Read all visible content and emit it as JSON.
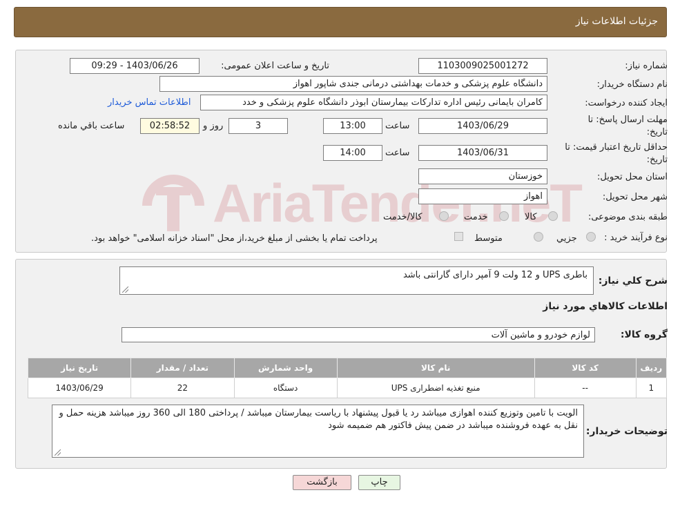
{
  "header": {
    "title": "جزئیات اطلاعات نیاز"
  },
  "labels": {
    "need_number": "شماره نیاز:",
    "announce_datetime": "تاریخ و ساعت اعلان عمومی:",
    "buyer_org": "نام دستگاه خریدار:",
    "requester": "ایجاد کننده درخواست:",
    "deadline_line1": "مهلت ارسال پاسخ: تا",
    "deadline_line2": "تاریخ:",
    "time_word": "ساعت",
    "day_word": "روز و",
    "remaining_suffix": "ساعت باقي مانده",
    "validity_line1": "حداقل تاریخ اعتبار قیمت: تا",
    "validity_line2": "تاریخ:",
    "province": "استان محل تحویل:",
    "city": "شهر محل تحویل:",
    "category": "طبقه بندی موضوعی:",
    "process_type": "نوع فرآیند خرید :",
    "general_desc": "شرح کلي نياز:",
    "goods_info": "اطلاعات کالاهاي مورد نياز",
    "goods_group": "گروه کالا:",
    "buyer_notes": "توضیحات خریدار:"
  },
  "fields": {
    "need_number": "1103009025001272",
    "announce_datetime": "1403/06/26 - 09:29",
    "buyer_org": "دانشگاه علوم پزشکی و خدمات بهداشتی درمانی جندی شاپور اهواز",
    "requester": "کامران بایمانی رئیس اداره تدارکات بیمارستان ابوذر  دانشگاه علوم پزشکی و خدد",
    "contact_link": "اطلاعات تماس خریدار",
    "deadline_date": "1403/06/29",
    "deadline_time": "13:00",
    "days_remaining": "3",
    "time_remaining": "02:58:52",
    "validity_date": "1403/06/31",
    "validity_time": "14:00",
    "province": "خوزستان",
    "city": "اهواز",
    "general_desc": "باطری UPS و 12 ولت 9 آمپر دارای گارانتی باشد",
    "goods_group": "لوازم خودرو و ماشین آلات",
    "buyer_notes": "الویت با تامین وتوزیع کننده اهوازی  میباشد رد یا قبول پیشنهاد با ریاست بیمارستان میباشد / پرداختی 180 الی 360 روز میباشد  هزینه حمل و نقل به عهده فروشنده میباشد  در ضمن پیش فاکتور هم ضمیمه شود"
  },
  "category_options": [
    "کالا",
    "خدمت",
    "کالا/خدمت"
  ],
  "process_options": [
    "جزیي",
    "متوسط"
  ],
  "process_note": "پرداخت تمام یا بخشی از مبلغ خرید،از محل \"اسناد خزانه اسلامی\" خواهد بود.",
  "table": {
    "headers": [
      "ردیف",
      "کد کالا",
      "نام کالا",
      "واحد شمارش",
      "تعداد / مقدار",
      "تاریخ نیاز"
    ],
    "rows": [
      {
        "row": "1",
        "code": "--",
        "name": "منبع تغذیه اضطراری UPS",
        "unit": "دستگاه",
        "qty": "22",
        "date": "1403/06/29"
      }
    ]
  },
  "buttons": {
    "print": "چاپ",
    "back": "بازگشت"
  },
  "watermark": "AriaTender.neT",
  "colors": {
    "header_bg": "#8a6a3f",
    "link": "#1e5bd8",
    "back_btn": "#f6d7d7",
    "print_btn": "#e7f6e2"
  }
}
